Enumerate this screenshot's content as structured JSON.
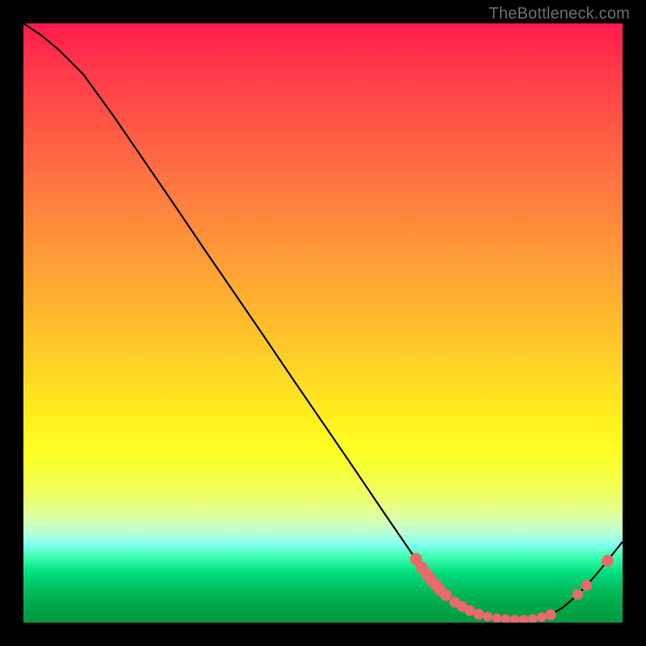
{
  "attribution": "TheBottleneck.com",
  "colors": {
    "background": "#000000",
    "gradient_top": "#ff1a4d",
    "gradient_bottom": "#009a40",
    "curve": "#000000",
    "marker": "#e86a6a"
  },
  "chart_data": {
    "type": "line",
    "title": "",
    "xlabel": "",
    "ylabel": "",
    "xlim": [
      0,
      100
    ],
    "ylim": [
      0,
      100
    ],
    "series": [
      {
        "name": "curve",
        "x": [
          0,
          3,
          6,
          10,
          15,
          20,
          25,
          30,
          35,
          40,
          45,
          50,
          55,
          60,
          65,
          68,
          70,
          72,
          74,
          76,
          78,
          80,
          82,
          84,
          86,
          88,
          90,
          92,
          94,
          96,
          98,
          100
        ],
        "y": [
          100,
          98,
          95.5,
          91.5,
          84.6,
          77.3,
          70.0,
          62.6,
          55.3,
          48.0,
          40.6,
          33.3,
          26.0,
          18.6,
          11.3,
          7.2,
          5.0,
          3.4,
          2.2,
          1.4,
          0.9,
          0.6,
          0.5,
          0.5,
          0.7,
          1.3,
          2.5,
          4.2,
          6.2,
          8.5,
          11.0,
          13.5
        ]
      }
    ],
    "markers": [
      {
        "x": 65.5,
        "y": 10.6,
        "r": 1.0
      },
      {
        "x": 66.5,
        "y": 9.2,
        "r": 1.0
      },
      {
        "x": 67.3,
        "y": 8.1,
        "r": 1.0
      },
      {
        "x": 68.0,
        "y": 7.2,
        "r": 1.0
      },
      {
        "x": 68.8,
        "y": 6.3,
        "r": 1.0
      },
      {
        "x": 69.5,
        "y": 5.5,
        "r": 1.0
      },
      {
        "x": 70.5,
        "y": 4.6,
        "r": 1.0
      },
      {
        "x": 72.0,
        "y": 3.4,
        "r": 0.9
      },
      {
        "x": 73.2,
        "y": 2.7,
        "r": 0.9
      },
      {
        "x": 74.5,
        "y": 2.0,
        "r": 0.9
      },
      {
        "x": 76.0,
        "y": 1.4,
        "r": 0.9
      },
      {
        "x": 77.5,
        "y": 1.0,
        "r": 0.8
      },
      {
        "x": 79.0,
        "y": 0.7,
        "r": 0.8
      },
      {
        "x": 80.5,
        "y": 0.6,
        "r": 0.8
      },
      {
        "x": 82.0,
        "y": 0.5,
        "r": 0.8
      },
      {
        "x": 83.5,
        "y": 0.5,
        "r": 0.8
      },
      {
        "x": 85.0,
        "y": 0.6,
        "r": 0.8
      },
      {
        "x": 86.5,
        "y": 0.9,
        "r": 0.8
      },
      {
        "x": 88.0,
        "y": 1.3,
        "r": 0.9
      },
      {
        "x": 92.5,
        "y": 4.7,
        "r": 0.9
      },
      {
        "x": 94.0,
        "y": 6.2,
        "r": 0.9
      },
      {
        "x": 97.5,
        "y": 10.3,
        "r": 1.0
      }
    ]
  }
}
